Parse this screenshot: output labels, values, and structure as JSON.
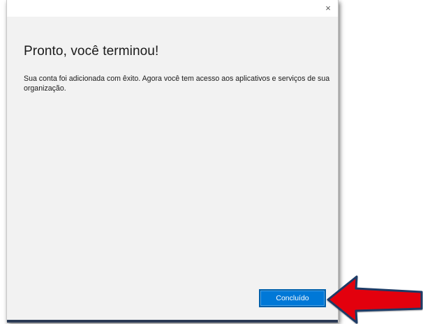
{
  "dialog": {
    "close_glyph": "×",
    "heading": "Pronto, você terminou!",
    "message": "Sua conta foi adicionada com êxito. Agora você tem acesso aos aplicativos e serviços de sua organização.",
    "done_label": "Concluído"
  },
  "annotation": {
    "arrow_color": "#e3000f",
    "arrow_outline": "#1f3a66",
    "points_to": "done-button"
  },
  "colors": {
    "accent": "#0078d7",
    "dialog_bg": "#f2f2f2"
  }
}
